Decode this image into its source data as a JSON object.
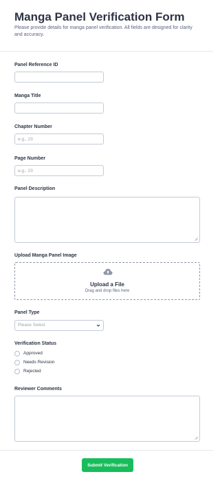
{
  "form": {
    "title": "Manga Panel Verification Form",
    "subtitle": "Please provide details for manga panel verification. All fields are designed for clarity and accuracy."
  },
  "fields": {
    "panel_reference_id": {
      "label": "Panel Reference ID",
      "value": "",
      "placeholder": ""
    },
    "manga_title": {
      "label": "Manga Title",
      "value": "",
      "placeholder": ""
    },
    "chapter_number": {
      "label": "Chapter Number",
      "value": "",
      "placeholder": "e.g., 23"
    },
    "page_number": {
      "label": "Page Number",
      "value": "",
      "placeholder": "e.g., 23"
    },
    "panel_description": {
      "label": "Panel Description",
      "value": ""
    },
    "upload": {
      "label": "Upload Manga Panel Image",
      "title": "Upload a File",
      "subtitle": "Drag and drop files here",
      "icon": "cloud-upload-icon"
    },
    "panel_type": {
      "label": "Panel Type",
      "selected": "Please Select",
      "icon": "chevron-down-icon"
    },
    "verification_status": {
      "label": "Verification Status",
      "options": [
        "Approved",
        "Needs Revision",
        "Rejected"
      ]
    },
    "reviewer_comments": {
      "label": "Reviewer Comments",
      "value": ""
    }
  },
  "submit_label": "Submit Verification",
  "colors": {
    "accent": "#18bd5b",
    "text": "#2c3345",
    "muted": "#57647e",
    "border": "#c3cad8"
  }
}
